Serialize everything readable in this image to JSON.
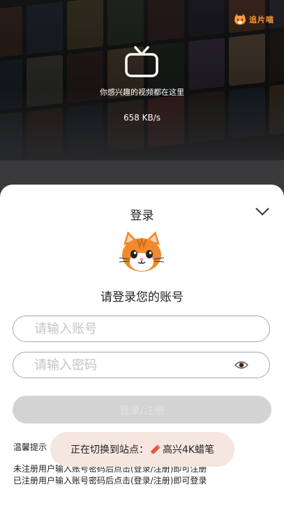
{
  "hero": {
    "brand_name": "追片喵",
    "caption": "你感兴趣的视频都在这里",
    "speed": "658 KB/s"
  },
  "login_sheet": {
    "title": "登录",
    "subtitle": "请登录您的账号",
    "account_placeholder": "请输入账号",
    "password_placeholder": "请输入密码",
    "submit_label": "登录/注册",
    "tips_title": "温馨提示",
    "tips": [
      "未注册用户输入账号密码后点击(登录/注册)即可注册",
      "已注册用户输入账号密码后点击(登录/注册)即可登录"
    ]
  },
  "toast": {
    "prefix": "正在切换到站点：",
    "site_name": "高兴4K蜡笔"
  },
  "icons": {
    "tv": "tv-icon",
    "chevron": "chevron-down-icon",
    "eye": "eye-icon",
    "pencil": "pencil-icon",
    "cat": "cat-logo-icon"
  },
  "colors": {
    "brand_orange": "#ff9a3c",
    "sheet_bg": "#ffffff",
    "button_disabled": "#d3d3d3",
    "toast_bg": "#f6e6e0"
  }
}
